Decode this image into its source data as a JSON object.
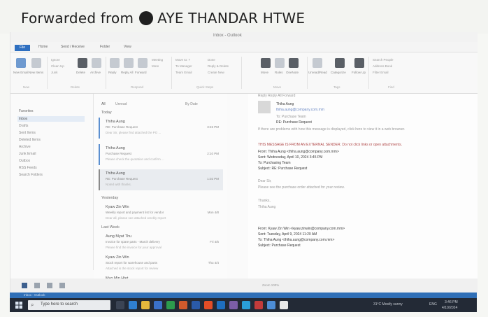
{
  "banner": {
    "forwarded_from": "Forwarded from",
    "name": "AYE THANDAR HTWE"
  },
  "window": {
    "title": "Inbox - Outlook"
  },
  "menu": {
    "tabs": [
      "File",
      "Home",
      "Send / Receive",
      "Folder",
      "View"
    ]
  },
  "ribbon": {
    "new": [
      "New Email",
      "New Items"
    ],
    "delete": [
      "Ignore",
      "Clean Up",
      "Junk",
      "Delete",
      "Archive"
    ],
    "respond": [
      "Reply",
      "Reply All",
      "Forward",
      "Meeting",
      "More"
    ],
    "quick_steps": [
      "Move to: ?",
      "To Manager",
      "Team Email",
      "Done",
      "Reply & Delete",
      "Create New"
    ],
    "move": [
      "Move",
      "Rules",
      "OneNote"
    ],
    "tags": [
      "Unread/Read",
      "Categorize",
      "Follow Up"
    ],
    "find": [
      "Search People",
      "Address Book",
      "Filter Email"
    ],
    "groups": [
      "New",
      "Delete",
      "Respond",
      "Quick Steps",
      "Move",
      "Tags",
      "Find"
    ]
  },
  "folders": {
    "header": "Favorites",
    "items": [
      "Inbox",
      "Drafts",
      "Sent Items",
      "Deleted Items",
      "Archive",
      "Junk Email",
      "Outbox",
      "RSS Feeds",
      "Search Folders"
    ]
  },
  "list": {
    "tabs": [
      "All",
      "Unread"
    ],
    "sort": "By Date",
    "groups": [
      "Today",
      "Yesterday",
      "Last Week"
    ],
    "today": [
      {
        "from": "Thiha Aung",
        "subject": "RE: Purchase Request",
        "preview": "Dear Sir, please find attached the PO ...",
        "time": "3:45 PM"
      },
      {
        "from": "Thiha Aung",
        "subject": "Purchase Request",
        "preview": "Please check the quotation and confirm ...",
        "time": "2:10 PM"
      },
      {
        "from": "Thiha Aung",
        "subject": "RE: Purchase Request",
        "preview": "Noted with thanks.",
        "time": "1:02 PM"
      }
    ],
    "yesterday": [
      {
        "from": "Kyaw Zin Win",
        "subject": "Weekly report and payment list for vendor",
        "preview": "Dear all, please see attached weekly report",
        "time": "Mon 4/8"
      }
    ],
    "lastweek": [
      {
        "from": "Aung Myat Thu",
        "subject": "Invoice for spare parts - March delivery",
        "preview": "Please find the invoice for your approval",
        "time": "Fri 4/5"
      },
      {
        "from": "Kyaw Zin Win",
        "subject": "Stock report for warehouse and parts",
        "preview": "Attached is the stock report for review",
        "time": "Thu 4/4"
      },
      {
        "from": "Myo Min Htet",
        "subject": "Payment confirmation",
        "preview": "Payment has been transferred today",
        "time": "Wed 4/3"
      }
    ]
  },
  "reading": {
    "reply_bar": "Reply   Reply All   Forward",
    "from_name": "Thiha Aung",
    "from_email": "thiha.aung@company.com.mm",
    "to": "To: Purchase Team",
    "subject": "RE: Purchase Request",
    "forwarded_note": "If there are problems with how this message is displayed, click here to view it in a web browser.",
    "warning": "THIS MESSAGE IS FROM AN EXTERNAL SENDER. Do not click links or open attachments.",
    "hdr1_from": "From: Thiha Aung <thiha.aung@company.com.mm>",
    "hdr1_sent": "Sent: Wednesday, April 10, 2024 3:45 PM",
    "hdr1_to": "To: Purchasing Team",
    "hdr1_subject": "Subject: RE: Purchase Request",
    "body1": "Dear Sir,",
    "body2": "Please see the purchase order attached for your review.",
    "sign1": "Thanks,",
    "sign2": "Thiha Aung",
    "hdr2_from": "From: Kyaw Zin Win <kyaw.zinwin@company.com.mm>",
    "hdr2_sent": "Sent: Tuesday, April 9, 2024 11:20 AM",
    "hdr2_to": "To: Thiha Aung <thiha.aung@company.com.mm>",
    "hdr2_subject": "Subject: Purchase Request",
    "footer": "Zoom 100%"
  },
  "taskbar": {
    "search_placeholder": "Type here to search",
    "weather": "31°C Mostly sunny",
    "lang": "ENG",
    "time": "3:46 PM",
    "date": "4/10/2024"
  },
  "colors": {
    "accent": "#2f6fb7",
    "taskbar": "#232a36"
  }
}
